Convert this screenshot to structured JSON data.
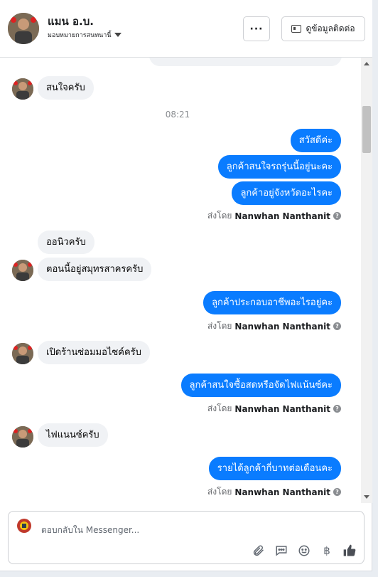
{
  "header": {
    "name": "แมน อ.บ.",
    "assign_label": "มอบหมายการสนทนานี้",
    "more_label": "···",
    "contact_label": "ดูข้อมูลติดต่อ"
  },
  "chat": {
    "timestamp": "08:21",
    "messages": {
      "m1": "สนใจครับ",
      "m2": "สวัสดีค่ะ",
      "m3": "ลูกค้าสนใจรถรุ่นนี้อยู่นะคะ",
      "m4": "ลูกค้าอยู่จังหวัดอะไรคะ",
      "m5": "ออนิวครับ",
      "m6": "ตอนนี้อยู่สมุทรสาครครับ",
      "m7": "ลูกค้าประกอบอาชีพอะไรอยู่คะ",
      "m8": "เปิดร้านซ่อมมอไซค์ครับ",
      "m9": "ลูกค้าสนใจซื้อสดหรือจัดไฟแน้นซ์คะ",
      "m10": "ไฟแนนซ์ครับ",
      "m11": "รายได้ลูกค้ากี่บาทต่อเดือนคะ"
    },
    "sent_by_prefix": "ส่งโดย",
    "sent_by_name": "Nanwhan Nanthanit",
    "info_glyph": "?"
  },
  "composer": {
    "placeholder": "ตอบกลับใน Messenger...",
    "icons": [
      "paperclip-icon",
      "saved-reply-icon",
      "emoji-icon",
      "baht-icon",
      "thumbs-up-icon"
    ],
    "baht_glyph": "฿"
  },
  "colors": {
    "outgoing": "#0a7cff",
    "incoming": "#f0f2f5"
  }
}
